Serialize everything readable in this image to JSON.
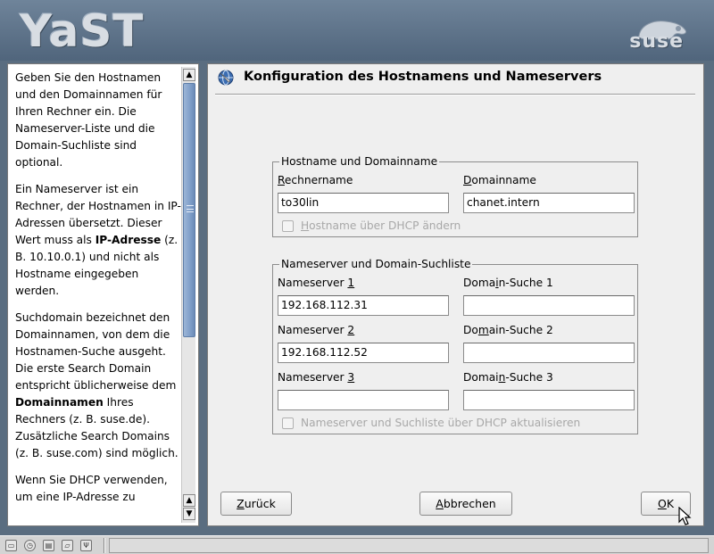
{
  "header": {
    "app_logo": "YaST",
    "vendor_logo": "suse"
  },
  "help": {
    "paragraphs": [
      "Geben Sie den Hostnamen und den Domainnamen für Ihren Rechner ein. Die Nameserver-Liste und die Domain-Suchliste sind optional.",
      "Ein Nameserver ist ein Rechner, der Hostnamen in IP-Adressen übersetzt. Dieser Wert muss als ",
      "Suchdomain bezeichnet den Domainnamen, von dem die Hostnamen-Suche ausgeht. Die erste Search Domain entspricht üblicherweise dem ",
      "Wenn Sie DHCP verwenden, um eine IP-Adresse zu"
    ],
    "p2_bold": "IP-Adresse",
    "p2_rest": " (z. B. 10.10.0.1) und nicht als Hostname eingegeben werden.",
    "p3_bold": "Domainnamen",
    "p3_rest": " Ihres Rechners (z. B. suse.de). Zusätzliche Search Domains (z. B. suse.com) sind möglich."
  },
  "main": {
    "title": "Konfiguration des Hostnamens und Nameservers",
    "hostname_group": {
      "legend": "Hostname und Domainname",
      "hostname_label_first": "R",
      "hostname_label_rest": "echnername",
      "hostname_value": "to30lin",
      "domain_label_first": "D",
      "domain_label_rest": "omainname",
      "domain_value": "chanet.intern",
      "dhcp_checkbox_first": "H",
      "dhcp_checkbox_rest": "ostname über DHCP ändern",
      "dhcp_checked": false
    },
    "nameserver_group": {
      "legend": "Nameserver und Domain-Suchliste",
      "ns1_label_pre": "Nameserver ",
      "ns1_label_ul": "1",
      "ns1_value": "192.168.112.31",
      "ns2_label_pre": "Nameserver ",
      "ns2_label_ul": "2",
      "ns2_value": "192.168.112.52",
      "ns3_label_pre": "Nameserver ",
      "ns3_label_ul": "3",
      "ns3_value": "",
      "ds1_label_pre": "Doma",
      "ds1_label_ul": "i",
      "ds1_label_post": "n-Suche 1",
      "ds1_value": "",
      "ds2_label_pre": "Do",
      "ds2_label_ul": "m",
      "ds2_label_post": "ain-Suche 2",
      "ds2_value": "",
      "ds3_label_pre": "Domai",
      "ds3_label_ul": "n",
      "ds3_label_post": "-Suche 3",
      "ds3_value": "",
      "dhcp_update_label": "Nameserver und Suchliste über DHCP aktualisieren",
      "dhcp_update_checked": false
    },
    "buttons": {
      "back_ul": "Z",
      "back_rest": "urück",
      "cancel_ul": "A",
      "cancel_rest": "bbrechen",
      "ok_ul": "O",
      "ok_rest": "K"
    }
  },
  "colors": {
    "banner": "#5f7489",
    "panel": "#efefef",
    "scroll_thumb": "#7f9ec8"
  }
}
